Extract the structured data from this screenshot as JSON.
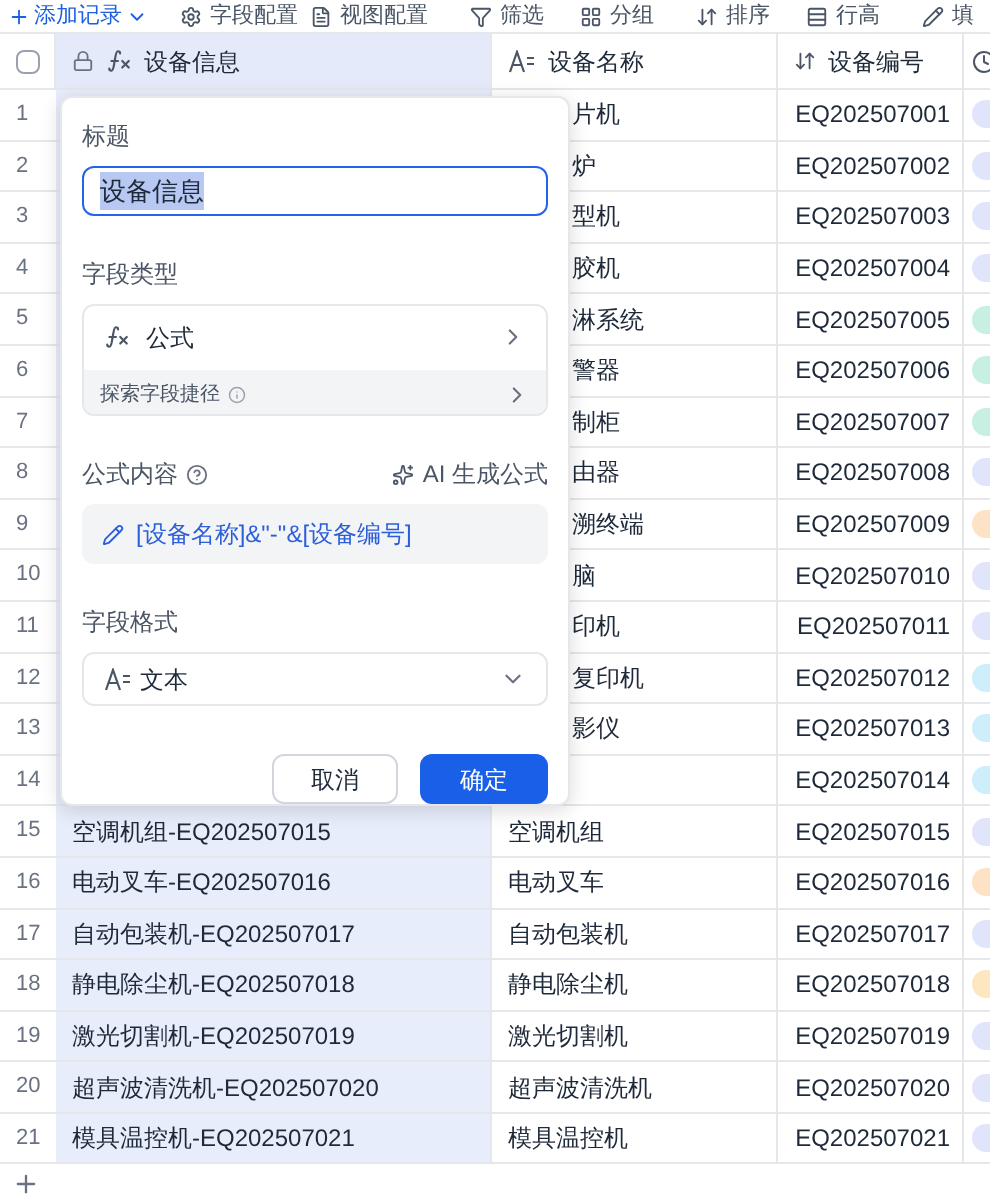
{
  "toolbar": {
    "add": "添加记录",
    "items": [
      "字段配置",
      "视图配置",
      "筛选",
      "分组",
      "排序",
      "行高",
      "填"
    ]
  },
  "table": {
    "select_all_checked": false,
    "columns": [
      "设备信息",
      "设备名称",
      "设备编号"
    ],
    "rows": [
      {
        "index": "1",
        "kind": "covered",
        "name": "片机",
        "code": "EQ202507001",
        "color": "#e1e5fb"
      },
      {
        "index": "2",
        "kind": "covered",
        "name": "炉",
        "code": "EQ202507002",
        "color": "#e1e5fb"
      },
      {
        "index": "3",
        "kind": "covered",
        "name": "型机",
        "code": "EQ202507003",
        "color": "#e1e5fb"
      },
      {
        "index": "4",
        "kind": "covered",
        "name": "胶机",
        "code": "EQ202507004",
        "color": "#e1e5fb"
      },
      {
        "index": "5",
        "kind": "covered",
        "name": "淋系统",
        "code": "EQ202507005",
        "color": "#c8f0e2"
      },
      {
        "index": "6",
        "kind": "covered",
        "name": "警器",
        "code": "EQ202507006",
        "color": "#c8f0e2"
      },
      {
        "index": "7",
        "kind": "covered",
        "name": "制柜",
        "code": "EQ202507007",
        "color": "#c8f0e2"
      },
      {
        "index": "8",
        "kind": "covered",
        "name": "由器",
        "code": "EQ202507008",
        "color": "#e1e5fb"
      },
      {
        "index": "9",
        "kind": "covered",
        "name": "溯终端",
        "code": "EQ202507009",
        "color": "#fde2c6"
      },
      {
        "index": "10",
        "kind": "covered",
        "name": "脑",
        "code": "EQ202507010",
        "color": "#e1e5fb"
      },
      {
        "index": "11",
        "kind": "covered",
        "name": "印机",
        "code": "EQ202507011",
        "color": "#e1e5fb"
      },
      {
        "index": "12",
        "kind": "covered",
        "name": "复印机",
        "code": "EQ202507012",
        "color": "#cdeefa"
      },
      {
        "index": "13",
        "kind": "covered",
        "name": "影仪",
        "code": "EQ202507013",
        "color": "#cdeefa"
      },
      {
        "index": "14",
        "kind": "covered",
        "code": "EQ202507014",
        "color": "#cdeefa"
      },
      {
        "index": "15",
        "kind": "full",
        "info": "空调机组-EQ202507015",
        "name": "空调机组",
        "code": "EQ202507015",
        "color": "#e1e5fb"
      },
      {
        "index": "16",
        "kind": "full",
        "info": "电动叉车-EQ202507016",
        "name": "电动叉车",
        "code": "EQ202507016",
        "color": "#fde2c6"
      },
      {
        "index": "17",
        "kind": "full",
        "info": "自动包装机-EQ202507017",
        "name": "自动包装机",
        "code": "EQ202507017",
        "color": "#e1e5fb"
      },
      {
        "index": "18",
        "kind": "full",
        "info": "静电除尘机-EQ202507018",
        "name": "静电除尘机",
        "code": "EQ202507018",
        "color": "#fde7c0"
      },
      {
        "index": "19",
        "kind": "full",
        "info": "激光切割机-EQ202507019",
        "name": "激光切割机",
        "code": "EQ202507019",
        "color": "#e1e5fb"
      },
      {
        "index": "20",
        "kind": "full",
        "info": "超声波清洗机-EQ202507020",
        "name": "超声波清洗机",
        "code": "EQ202507020",
        "color": "#e1e5fb"
      },
      {
        "index": "21",
        "kind": "full",
        "info": "模具温控机-EQ202507021",
        "name": "模具温控机",
        "code": "EQ202507021",
        "color": "#e1e5fb"
      }
    ]
  },
  "popup": {
    "title_label": "标题",
    "title_value": "设备信息",
    "type_label": "字段类型",
    "type_value": "公式",
    "explore": "探索字段捷径",
    "formula_label": "公式内容",
    "ai": "AI 生成公式",
    "formula": "[设备名称]&\"-\"&[设备编号]",
    "format_label": "字段格式",
    "format_value": "文本",
    "cancel": "取消",
    "confirm": "确定"
  }
}
